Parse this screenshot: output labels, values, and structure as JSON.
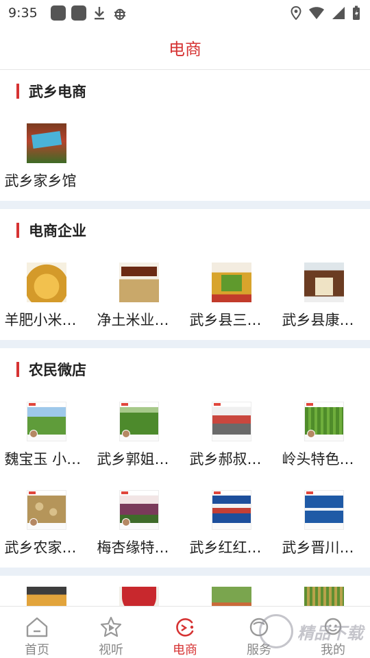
{
  "status": {
    "time": "9:35"
  },
  "header": {
    "title": "电商"
  },
  "sections": [
    {
      "title": "武乡电商",
      "items": [
        {
          "label": "武乡家乡馆",
          "thumb": "banner"
        }
      ]
    },
    {
      "title": "电商企业",
      "items": [
        {
          "label": "羊肥小米…",
          "thumb": "millet"
        },
        {
          "label": "净土米业…",
          "thumb": "rice"
        },
        {
          "label": "武乡县三…",
          "thumb": "box"
        },
        {
          "label": "武乡县康…",
          "thumb": "tea"
        }
      ]
    },
    {
      "title": "农民微店",
      "items": [
        {
          "label": "魏宝玉 小…",
          "thumb": "field"
        },
        {
          "label": "武乡郭姐…",
          "thumb": "corn"
        },
        {
          "label": "武乡郝叔…",
          "thumb": "people"
        },
        {
          "label": "岭头特色…",
          "thumb": "tall"
        },
        {
          "label": "武乡农家…",
          "thumb": "peanut"
        },
        {
          "label": "梅杏缘特…",
          "thumb": "woman"
        },
        {
          "label": "武乡红红…",
          "thumb": "red"
        },
        {
          "label": "武乡晋川…",
          "thumb": "blue"
        }
      ]
    }
  ],
  "partial_row": [
    {
      "thumb": "juice"
    },
    {
      "thumb": "redlogo"
    },
    {
      "thumb": "corn2"
    },
    {
      "thumb": "field2"
    }
  ],
  "nav": [
    {
      "label": "首页",
      "icon": "home-icon",
      "active": false
    },
    {
      "label": "视听",
      "icon": "play-icon",
      "active": false
    },
    {
      "label": "电商",
      "icon": "shop-icon",
      "active": true
    },
    {
      "label": "服务",
      "icon": "service-icon",
      "active": false
    },
    {
      "label": "我的",
      "icon": "profile-icon",
      "active": false
    }
  ],
  "watermark": {
    "text": "精品下载"
  },
  "colors": {
    "accent": "#d63333",
    "divider": "#eaf0f7",
    "nav_inactive": "#888888"
  }
}
